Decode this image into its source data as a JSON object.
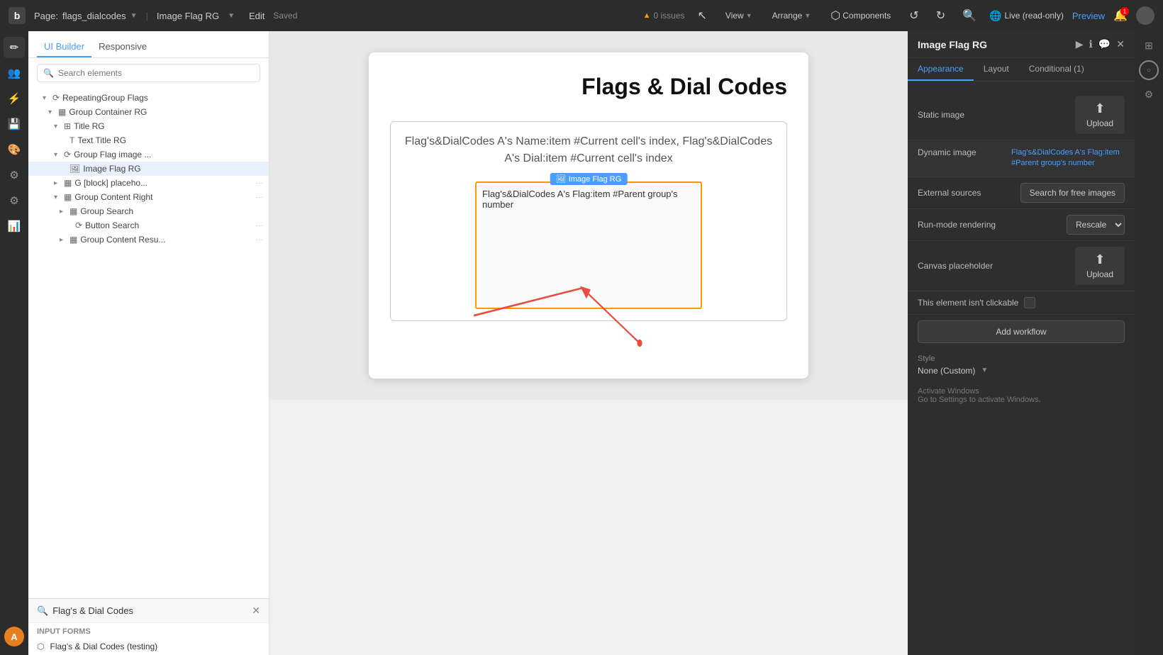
{
  "topbar": {
    "logo": "b",
    "page_label": "Page:",
    "page_name": "flags_dialcodes",
    "element_name": "Image Flag RG",
    "edit_label": "Edit",
    "saved_label": "Saved",
    "issues_count": "0 issues",
    "view_label": "View",
    "arrange_label": "Arrange",
    "components_label": "Components",
    "live_label": "Live (read-only)",
    "preview_label": "Preview",
    "notif_count": "1"
  },
  "left_panel": {
    "tab_builder": "UI Builder",
    "tab_responsive": "Responsive",
    "search_placeholder": "Search elements",
    "tree": [
      {
        "label": "RepeatingGroup Flags",
        "indent": 1,
        "icon": "⟳",
        "collapsed": false
      },
      {
        "label": "Group Container RG",
        "indent": 2,
        "icon": "▦",
        "collapsed": false
      },
      {
        "label": "Title RG",
        "indent": 3,
        "icon": "⊞",
        "collapsed": false
      },
      {
        "label": "Text Title RG",
        "indent": 4,
        "icon": "T"
      },
      {
        "label": "Group Flag image ...",
        "indent": 3,
        "icon": "⟳",
        "collapsed": false
      },
      {
        "label": "Image Flag RG",
        "indent": 4,
        "icon": "🖼",
        "selected": true
      },
      {
        "label": "G [block] placeho...",
        "indent": 3,
        "icon": "▦",
        "collapsed": true
      },
      {
        "label": "Group Content Right",
        "indent": 3,
        "icon": "▦",
        "collapsed": false,
        "dots": true
      },
      {
        "label": "Group Search",
        "indent": 4,
        "icon": "▦",
        "collapsed": true
      },
      {
        "label": "Button Search",
        "indent": 5,
        "icon": "⟳",
        "dots": true
      },
      {
        "label": "Group Content Resu...",
        "indent": 4,
        "icon": "▦",
        "collapsed": true,
        "dots": true
      }
    ]
  },
  "search_panel": {
    "title": "Flag's & Dial Codes",
    "section_input": "Input forms",
    "result_item": "Flag's & Dial Codes (testing)"
  },
  "canvas": {
    "page_title": "Flags & Dial Codes",
    "placeholder_text": "Flag's&DialCodes A's Name:item #Current cell's index, Flag's&DialCodes A's Dial:item #Current cell's index",
    "image_flag_label": "Image Flag RG",
    "image_text": "Flag's&DialCodes A's Flag:item #Parent group's number"
  },
  "right_panel": {
    "title": "Image Flag RG",
    "tab_appearance": "Appearance",
    "tab_layout": "Layout",
    "tab_conditional": "Conditional (1)",
    "static_image_label": "Static image",
    "upload_label": "Upload",
    "dynamic_image_label": "Dynamic image",
    "dynamic_value": "Flag's&DialCodes A's Flag:item #Parent group's number",
    "external_sources_label": "External sources",
    "search_free_images": "Search for free images",
    "run_mode_label": "Run-mode rendering",
    "run_mode_value": "Rescale",
    "canvas_placeholder_label": "Canvas placeholder",
    "not_clickable_label": "This element isn't clickable",
    "add_workflow_label": "Add workflow",
    "style_label": "Style",
    "style_value": "None (Custom)",
    "activate_windows": "Activate Windows",
    "go_to_settings": "Go to Settings to activate Windows."
  }
}
